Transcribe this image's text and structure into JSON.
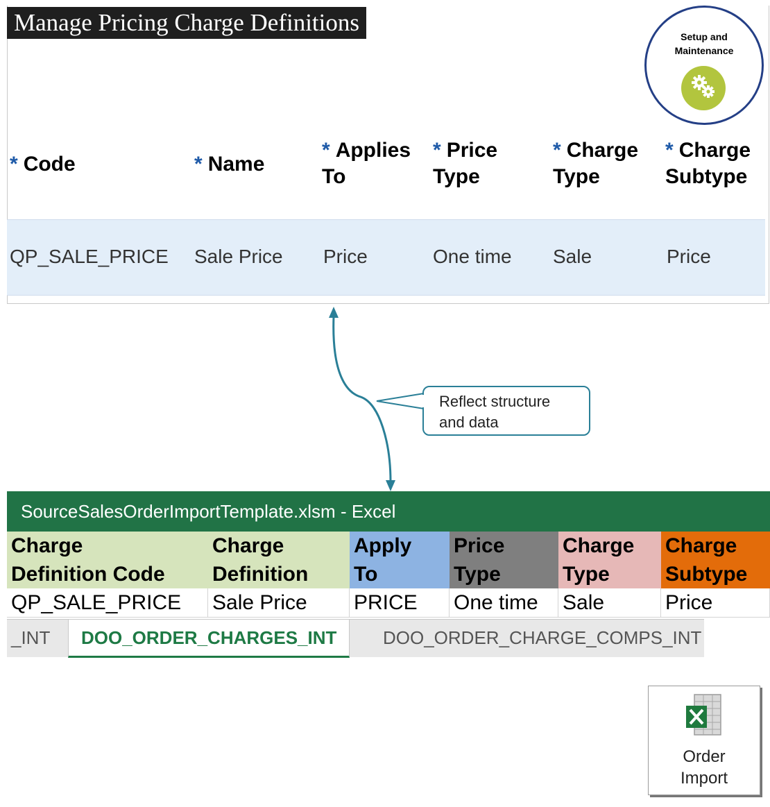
{
  "page": {
    "title": "Manage Pricing Charge Definitions",
    "setup_badge": {
      "line1": "Setup and",
      "line2": "Maintenance",
      "icon": "gears-icon"
    }
  },
  "table": {
    "required_marker": "*",
    "headers": [
      {
        "line1": "Code",
        "line2": ""
      },
      {
        "line1": "Name",
        "line2": ""
      },
      {
        "line1": "Applies",
        "line2": "To"
      },
      {
        "line1": "Price",
        "line2": "Type"
      },
      {
        "line1": "Charge",
        "line2": "Type"
      },
      {
        "line1": "Charge",
        "line2": "Subtype"
      }
    ],
    "row": [
      "QP_SALE_PRICE",
      "Sale Price",
      "Price",
      "One time",
      "Sale",
      "Price"
    ],
    "row_highlight": "#e3eef9"
  },
  "callout": {
    "line1": "Reflect structure",
    "line2": "and data"
  },
  "excel": {
    "window_title": "SourceSalesOrderImportTemplate.xlsm - Excel",
    "headers": [
      {
        "line1": "Charge",
        "line2": "Definition Code",
        "color": "#d6e4bc"
      },
      {
        "line1": "Charge",
        "line2": "Definition",
        "color": "#d6e4bc"
      },
      {
        "line1": "Apply",
        "line2": "To",
        "color": "#8db3e2"
      },
      {
        "line1": "Price",
        "line2": "Type",
        "color": "#7f7f7f"
      },
      {
        "line1": "Charge",
        "line2": "Type",
        "color": "#e6b8b7"
      },
      {
        "line1": "Charge",
        "line2": "Subtype",
        "color": "#e36c0a"
      }
    ],
    "row": [
      "QP_SALE_PRICE",
      "Sale Price",
      "PRICE",
      "One time",
      "Sale",
      "Price"
    ],
    "tabs": [
      "_INT",
      "DOO_ORDER_CHARGES_INT",
      "DOO_ORDER_CHARGE_COMPS_INT"
    ],
    "active_tab": "DOO_ORDER_CHARGES_INT"
  },
  "order_import": {
    "line1": "Order",
    "line2": "Import",
    "icon": "excel-icon"
  },
  "colors": {
    "excel_green": "#217346",
    "callout_teal": "#2a7f97",
    "required_blue": "#1e5aa8"
  }
}
